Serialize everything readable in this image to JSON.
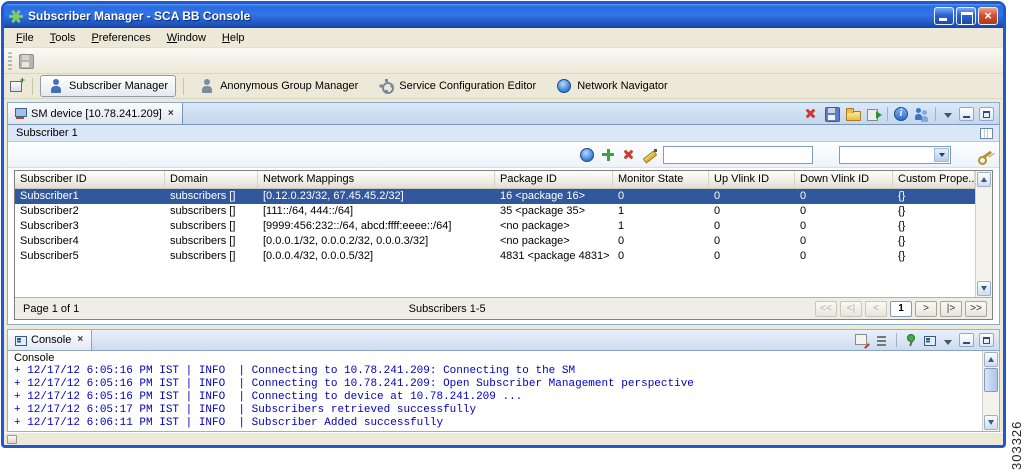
{
  "window": {
    "title": "Subscriber Manager - SCA BB Console"
  },
  "menu": {
    "items": [
      "File",
      "Tools",
      "Preferences",
      "Window",
      "Help"
    ]
  },
  "perspectives": [
    {
      "label": "Subscriber Manager",
      "active": true
    },
    {
      "label": "Anonymous Group Manager",
      "active": false
    },
    {
      "label": "Service Configuration Editor",
      "active": false
    },
    {
      "label": "Network Navigator",
      "active": false
    }
  ],
  "editor": {
    "tab_label": "SM device [10.78.241.209]",
    "subtitle": "Subscriber 1"
  },
  "filter": {
    "text_value": "",
    "select_value": ""
  },
  "table": {
    "columns": [
      "Subscriber ID",
      "Domain",
      "Network Mappings",
      "Package ID",
      "Monitor State",
      "Up Vlink ID",
      "Down Vlink ID",
      "Custom Prope..."
    ],
    "rows": [
      {
        "selected": true,
        "cells": [
          "Subscriber1",
          "subscribers []",
          "[0.12.0.23/32, 67.45.45.2/32]",
          "16 <package 16>",
          "0",
          "0",
          "0",
          "{}"
        ]
      },
      {
        "selected": false,
        "cells": [
          "Subscriber2",
          "subscribers []",
          "[111::/64, 444::/64]",
          "35 <package 35>",
          "1",
          "0",
          "0",
          "{}"
        ]
      },
      {
        "selected": false,
        "cells": [
          "Subscriber3",
          "subscribers []",
          "[9999:456:232::/64, abcd:ffff:eeee::/64]",
          "<no package>",
          "1",
          "0",
          "0",
          "{}"
        ]
      },
      {
        "selected": false,
        "cells": [
          "Subscriber4",
          "subscribers []",
          "[0.0.0.1/32, 0.0.0.2/32, 0.0.0.3/32]",
          "<no package>",
          "0",
          "0",
          "0",
          "{}"
        ]
      },
      {
        "selected": false,
        "cells": [
          "Subscriber5",
          "subscribers []",
          "[0.0.0.4/32, 0.0.0.5/32]",
          "4831 <package 4831>",
          "0",
          "0",
          "0",
          "{}"
        ]
      }
    ]
  },
  "pagination": {
    "page_label": "Page 1 of 1",
    "range_label": "Subscribers 1-5",
    "buttons": [
      {
        "label": "<<",
        "enabled": false,
        "current": false
      },
      {
        "label": "<|",
        "enabled": false,
        "current": false
      },
      {
        "label": "<",
        "enabled": false,
        "current": false
      },
      {
        "label": "1",
        "enabled": true,
        "current": true
      },
      {
        "label": ">",
        "enabled": true,
        "current": false
      },
      {
        "label": "|>",
        "enabled": true,
        "current": false
      },
      {
        "label": ">>",
        "enabled": true,
        "current": false
      }
    ]
  },
  "console": {
    "tab_label": "Console",
    "title": "Console",
    "lines": [
      "+ 12/17/12 6:05:16 PM IST | INFO  | Connecting to 10.78.241.209: Connecting to the SM",
      "+ 12/17/12 6:05:16 PM IST | INFO  | Connecting to 10.78.241.209: Open Subscriber Management perspective",
      "+ 12/17/12 6:05:16 PM IST | INFO  | Connecting to device at 10.78.241.209 ...",
      "+ 12/17/12 6:05:17 PM IST | INFO  | Subscribers retrieved successfully",
      "+ 12/17/12 6:06:11 PM IST | INFO  | Subscriber Added successfully"
    ]
  },
  "figure_number": "303326",
  "colors": {
    "selection": "#31589c",
    "console_text": "#0000c0",
    "titlebar_blue": "#2a6ce0",
    "frame_blue": "#2059cf"
  }
}
